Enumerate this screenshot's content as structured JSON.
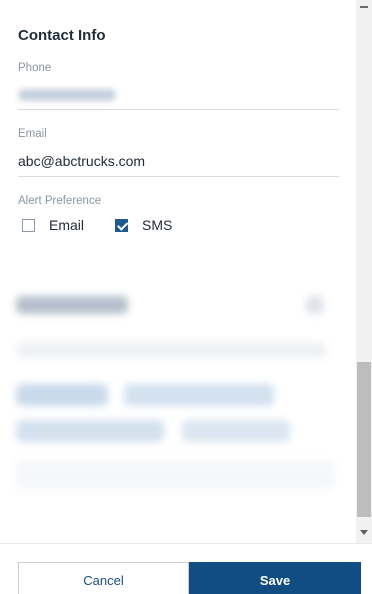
{
  "contact": {
    "title": "Contact Info",
    "phone_label": "Phone",
    "email_label": "Email",
    "email_value": "abc@abctrucks.com",
    "alert_label": "Alert Preference",
    "alert_options": [
      {
        "label": "Email",
        "checked": false
      },
      {
        "label": "SMS",
        "checked": true
      }
    ]
  },
  "footer": {
    "cancel_label": "Cancel",
    "save_label": "Save"
  },
  "colors": {
    "primary": "#114d83",
    "checkbox_checked": "#1e5a8e",
    "label": "#8a96a3",
    "divider": "#d9dde2"
  }
}
